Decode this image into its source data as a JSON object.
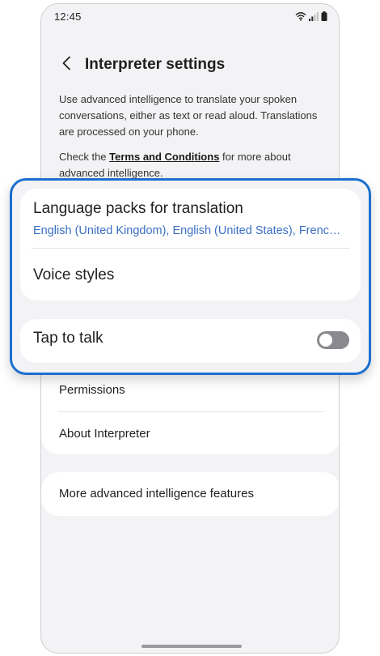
{
  "status_bar": {
    "time": "12:45",
    "icons": [
      "wifi-icon",
      "signal-icon",
      "battery-icon"
    ]
  },
  "header": {
    "title": "Interpreter settings",
    "back_icon": "chevron-left-icon"
  },
  "description": "Use advanced intelligence to translate your spoken conversations, either as text or read aloud. Translations are processed on your phone.",
  "terms": {
    "prefix": "Check the ",
    "link": "Terms and Conditions",
    "suffix": " for more about advanced intelligence."
  },
  "highlighted": {
    "language_packs": {
      "title": "Language packs for translation",
      "subtitle": "English (United Kingdom), English (United States), French (France), German (Germany)"
    },
    "voice_styles": {
      "title": "Voice styles"
    },
    "tap_to_talk": {
      "title": "Tap to talk",
      "enabled": false
    }
  },
  "list": {
    "permissions": "Permissions",
    "about": "About Interpreter",
    "more": "More advanced intelligence features"
  },
  "colors": {
    "highlight_border": "#1c6fd0",
    "link_blue": "#3a6fc4",
    "toggle_off": "#8a8a8e",
    "background": "#f3f3f5"
  }
}
